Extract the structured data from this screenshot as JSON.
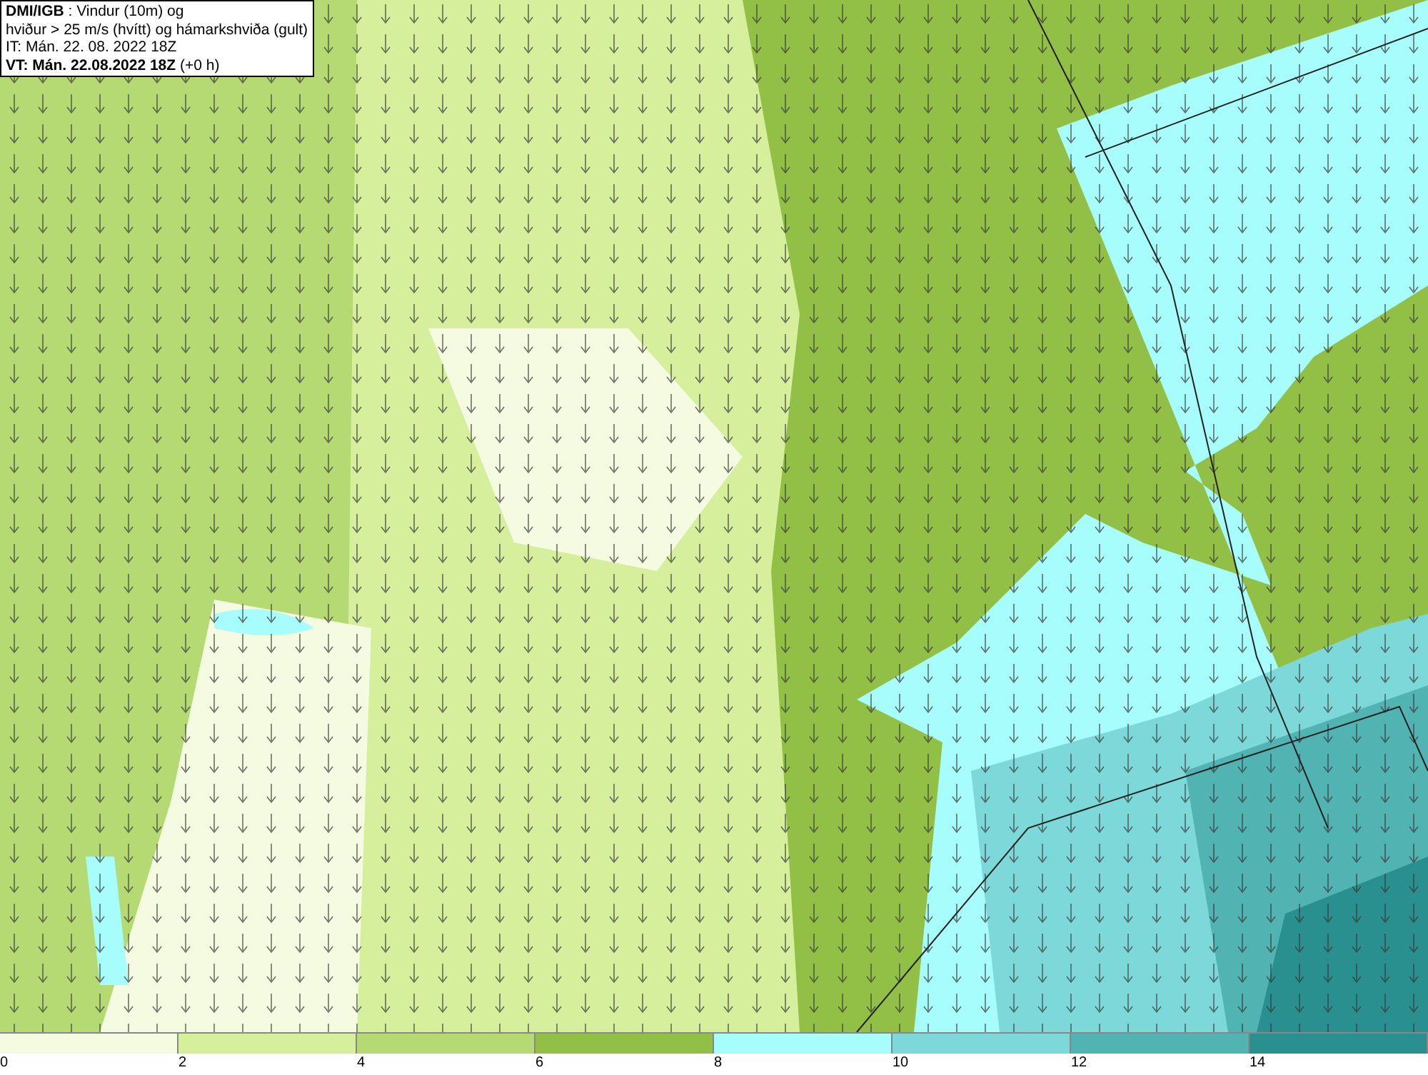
{
  "header": {
    "lines": [
      "**DMI/IGB** : Vindur (10m) og",
      "hviður > 25 m/s (hvítt) og hámarkshviða (gult)",
      "IT: Mán. 22. 08. 2022 18Z",
      "**VT: Mán. 22.08.2022 18Z** (+0 h)"
    ]
  },
  "legend": {
    "bins": [
      {
        "label": "0",
        "color": "#f5fbe0"
      },
      {
        "label": "2",
        "color": "#d6ef9c"
      },
      {
        "label": "4",
        "color": "#b5d973"
      },
      {
        "label": "6",
        "color": "#92bf45"
      },
      {
        "label": "8",
        "color": "#a6fdfb"
      },
      {
        "label": "10",
        "color": "#7dd9d9"
      },
      {
        "label": "12",
        "color": "#52b3b3"
      },
      {
        "label": "14",
        "color": "#2a8f8f"
      }
    ]
  }
}
